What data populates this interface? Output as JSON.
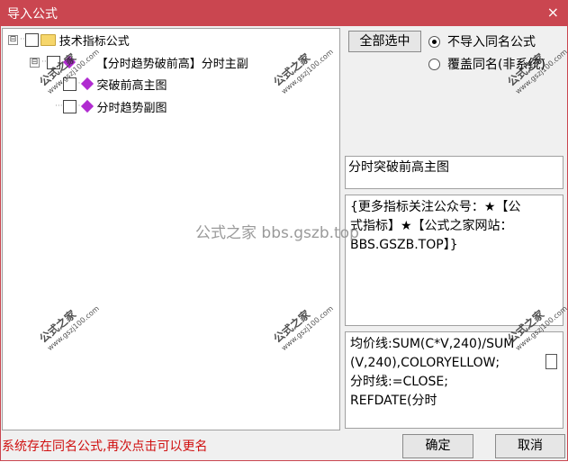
{
  "window": {
    "title": "导入公式",
    "close_icon": "×"
  },
  "tree": {
    "root": {
      "label": "技术指标公式",
      "expander": "⊟"
    },
    "child": {
      "label": "【分时趋势破前高】分时主副",
      "expander": "⊟"
    },
    "items": [
      {
        "label": "突破前高主图"
      },
      {
        "label": "分时趋势副图"
      }
    ]
  },
  "right": {
    "select_all": "全部选中",
    "options": [
      {
        "label": "不导入同名公式",
        "checked": true
      },
      {
        "label": "覆盖同名(非系统)",
        "checked": false
      }
    ],
    "name_box": "分时突破前高主图",
    "desc_lines": [
      "{更多指标关注公众号：★【公",
      "式指标】★【公式之家网站：",
      "BBS.GSZB.TOP】}"
    ],
    "code_lines": [
      "均价线:SUM(C*V,240)/SUM",
      "(V,240),COLORYELLOW;",
      "分时线:=CLOSE;",
      "REFDATE(分时"
    ]
  },
  "status": "系统存在同名公式,再次点击可以更名",
  "buttons": {
    "ok": "确定",
    "cancel": "取消"
  },
  "watermarks": {
    "text": "公式之家",
    "url": "www.gszj100.com",
    "big": "公式之家 bbs.gszb.top"
  },
  "colors": {
    "titlebar": "#ca4650",
    "status": "#d01010",
    "formula_icon": "#b02bd0"
  }
}
